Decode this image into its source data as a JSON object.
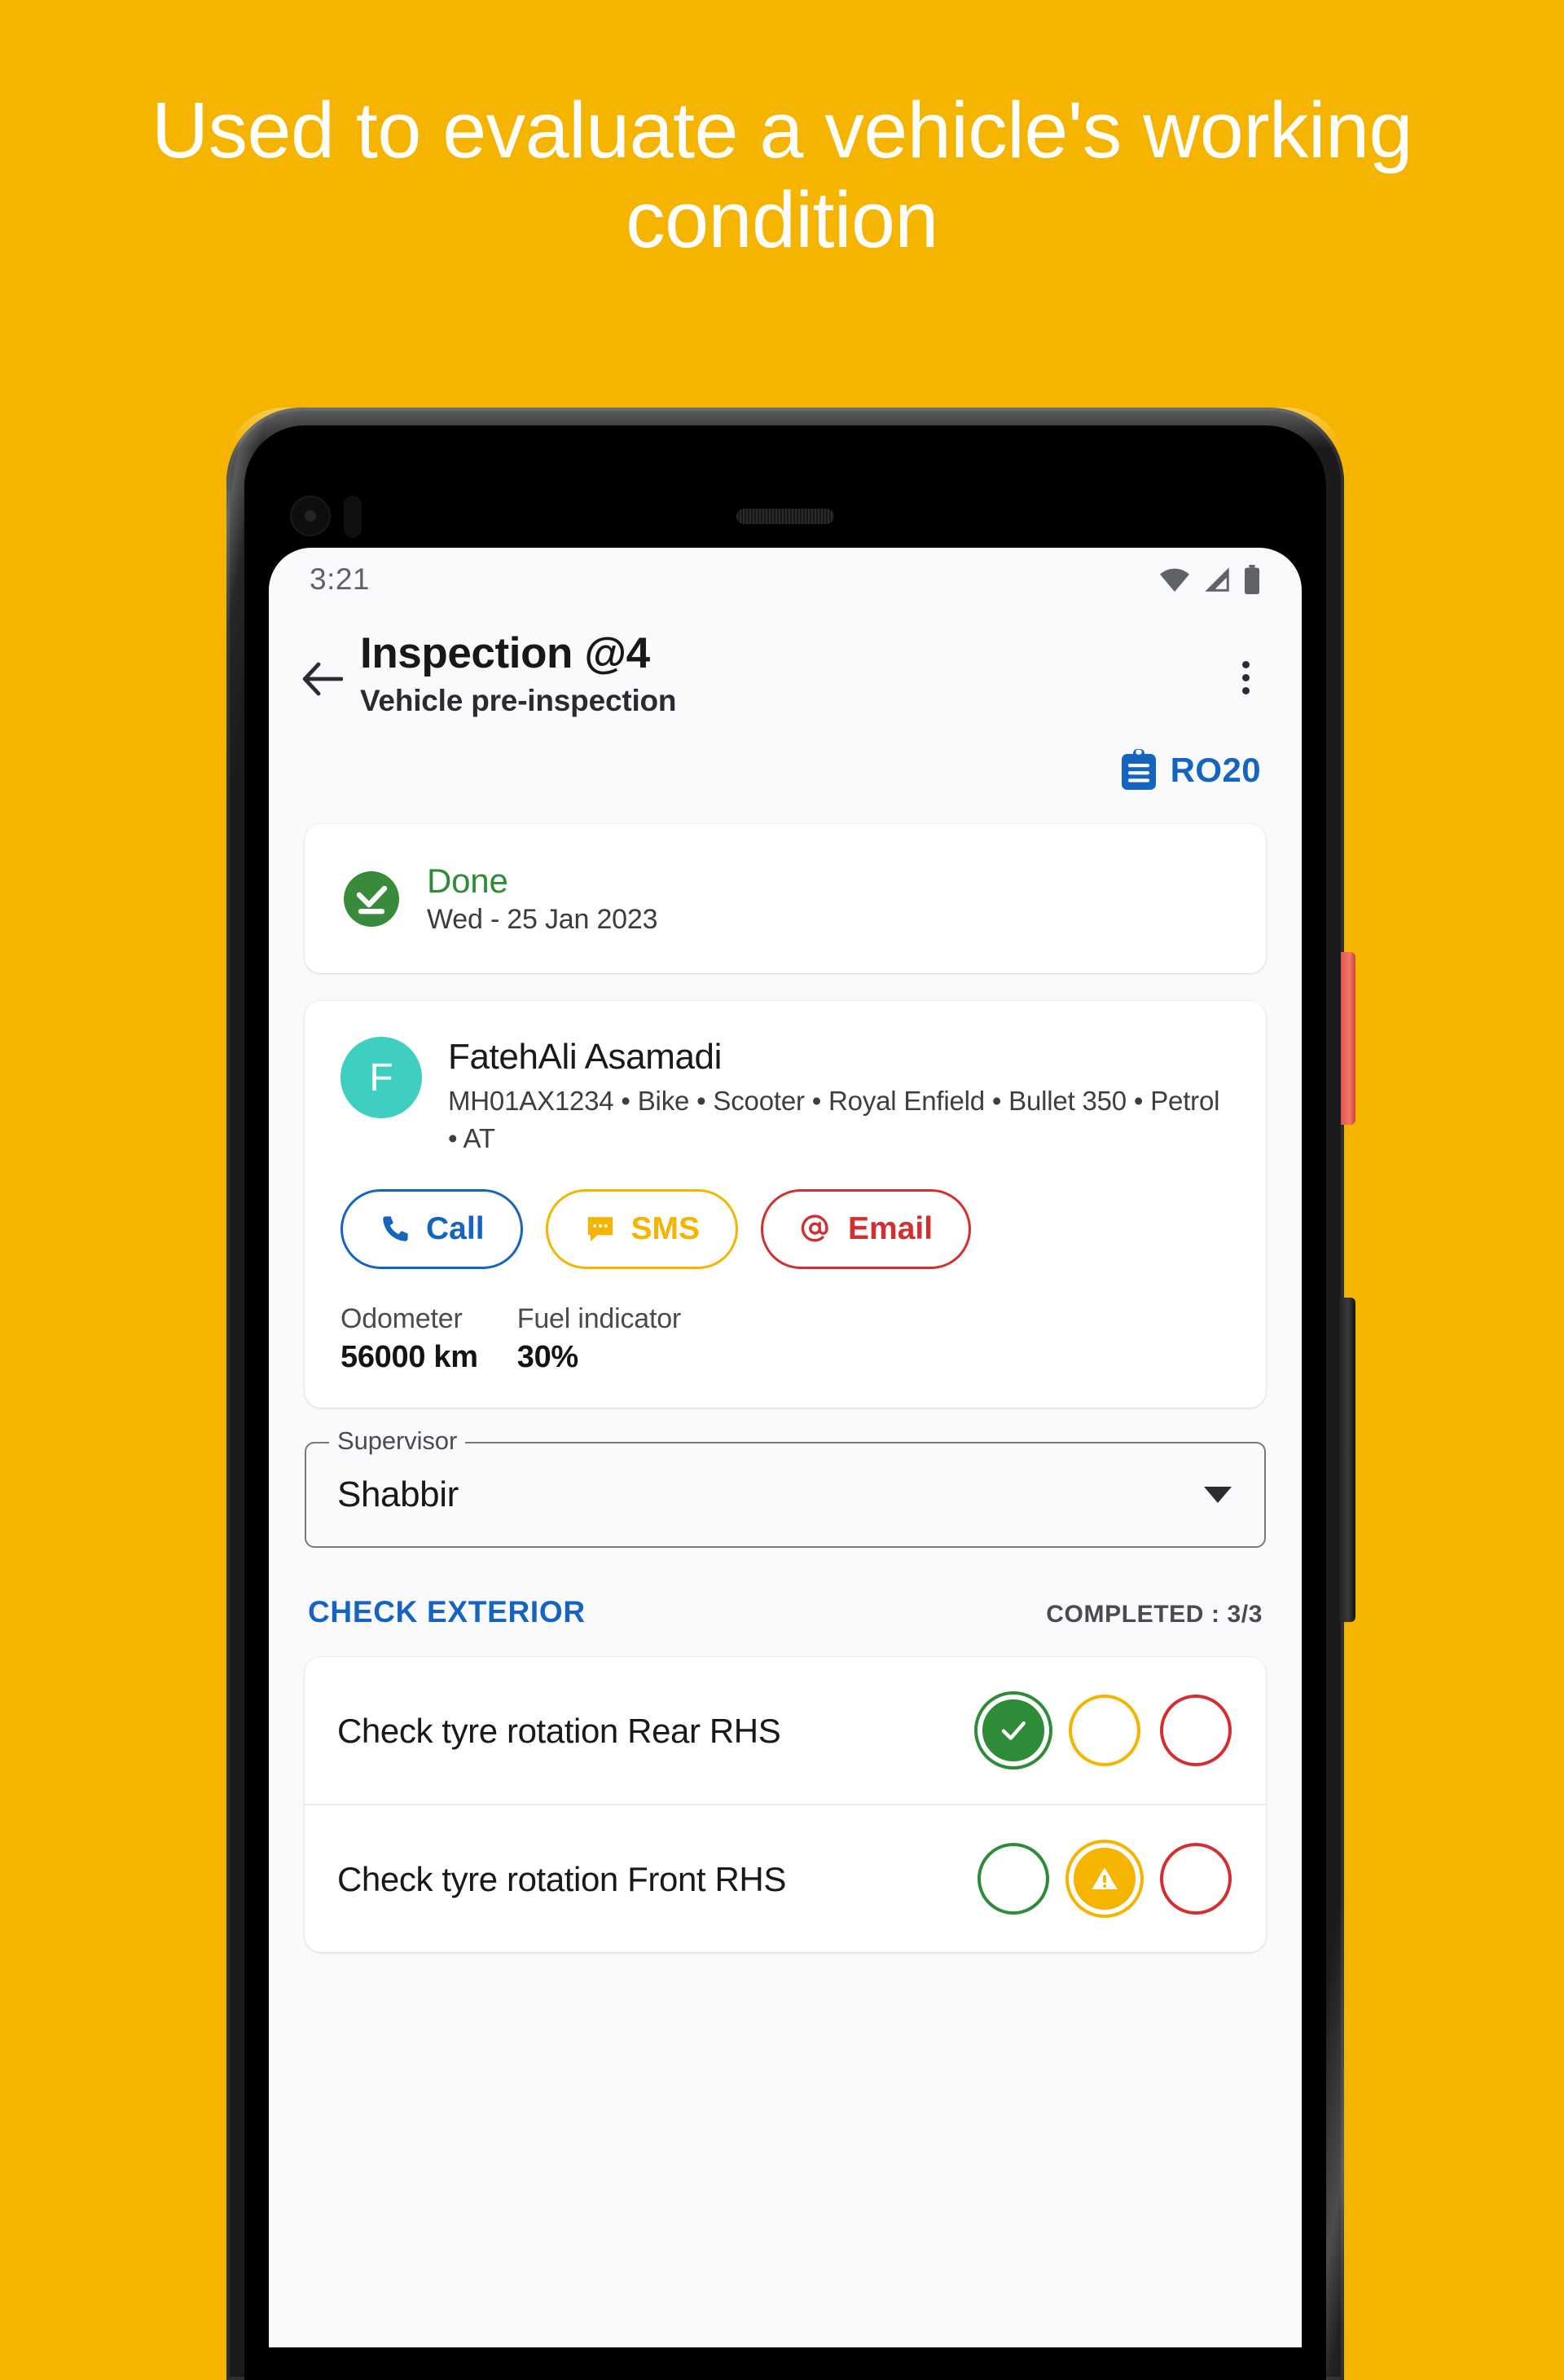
{
  "promo": {
    "headline": "Used to evaluate a vehicle's working condition",
    "background_color": "#F5B400"
  },
  "status_bar": {
    "time": "3:21",
    "icons": [
      "wifi-icon",
      "cellular-signal-icon",
      "battery-icon"
    ]
  },
  "app_bar": {
    "back_icon": "arrow-back-icon",
    "title": "Inspection @4",
    "subtitle": "Vehicle pre-inspection",
    "overflow_icon": "more-vert-icon"
  },
  "ro_badge": {
    "icon": "clipboard-icon",
    "label": "RO20",
    "color": "#1565C0"
  },
  "status_card": {
    "icon": "task-done-icon",
    "title": "Done",
    "title_color": "#2E8B38",
    "date": "Wed - 25 Jan 2023"
  },
  "customer_card": {
    "avatar_initial": "F",
    "avatar_color": "#3FCFC0",
    "name": "FatehAli Asamadi",
    "vehicle_details": "MH01AX1234 • Bike • Scooter • Royal Enfield • Bullet 350 • Petrol • AT",
    "actions": [
      {
        "label": "Call",
        "icon": "phone-icon",
        "color": "#1565C0"
      },
      {
        "label": "SMS",
        "icon": "sms-bubble-icon",
        "color": "#F4B400"
      },
      {
        "label": "Email",
        "icon": "at-sign-icon",
        "color": "#D32F2F"
      }
    ],
    "readings": [
      {
        "label": "Odometer",
        "value": "56000 km"
      },
      {
        "label": "Fuel indicator",
        "value": "30%"
      }
    ]
  },
  "supervisor_select": {
    "label": "Supervisor",
    "value": "Shabbir",
    "caret_icon": "chevron-down-icon"
  },
  "checklist_section": {
    "title": "CHECK EXTERIOR",
    "title_color": "#1565C0",
    "completed_text": "COMPLETED : 3/3",
    "rows": [
      {
        "label": "Check tyre rotation Rear RHS",
        "options": [
          {
            "name": "ok",
            "color": "#2E8B38",
            "selected": true,
            "icon": "check-icon"
          },
          {
            "name": "warning",
            "color": "#F4B400",
            "selected": false,
            "icon": "warning-triangle-icon"
          },
          {
            "name": "fail",
            "color": "#D32F2F",
            "selected": false,
            "icon": "close-icon"
          }
        ]
      },
      {
        "label": "Check tyre rotation Front RHS",
        "options": [
          {
            "name": "ok",
            "color": "#2E8B38",
            "selected": false,
            "icon": "check-icon"
          },
          {
            "name": "warning",
            "color": "#F4B400",
            "selected": true,
            "icon": "warning-triangle-icon"
          },
          {
            "name": "fail",
            "color": "#D32F2F",
            "selected": false,
            "icon": "close-icon"
          }
        ]
      }
    ]
  }
}
